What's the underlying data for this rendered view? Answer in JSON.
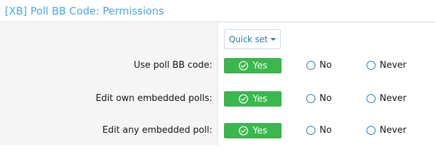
{
  "header": {
    "title": "[XB] Poll BB Code: Permissions"
  },
  "quick_set": {
    "label": "Quick set"
  },
  "options": {
    "yes": "Yes",
    "no": "No",
    "never": "Never"
  },
  "rows": [
    {
      "label": "Use poll BB code:",
      "selected": "yes"
    },
    {
      "label": "Edit own embedded polls:",
      "selected": "yes"
    },
    {
      "label": "Edit any embedded poll:",
      "selected": "yes"
    }
  ],
  "colors": {
    "accent": "#47a7eb",
    "yes_green": "#3ab84d",
    "link_blue": "#2577b1"
  },
  "icons": {
    "yes": "check-circle-icon",
    "quick_set": "caret-down-icon"
  }
}
